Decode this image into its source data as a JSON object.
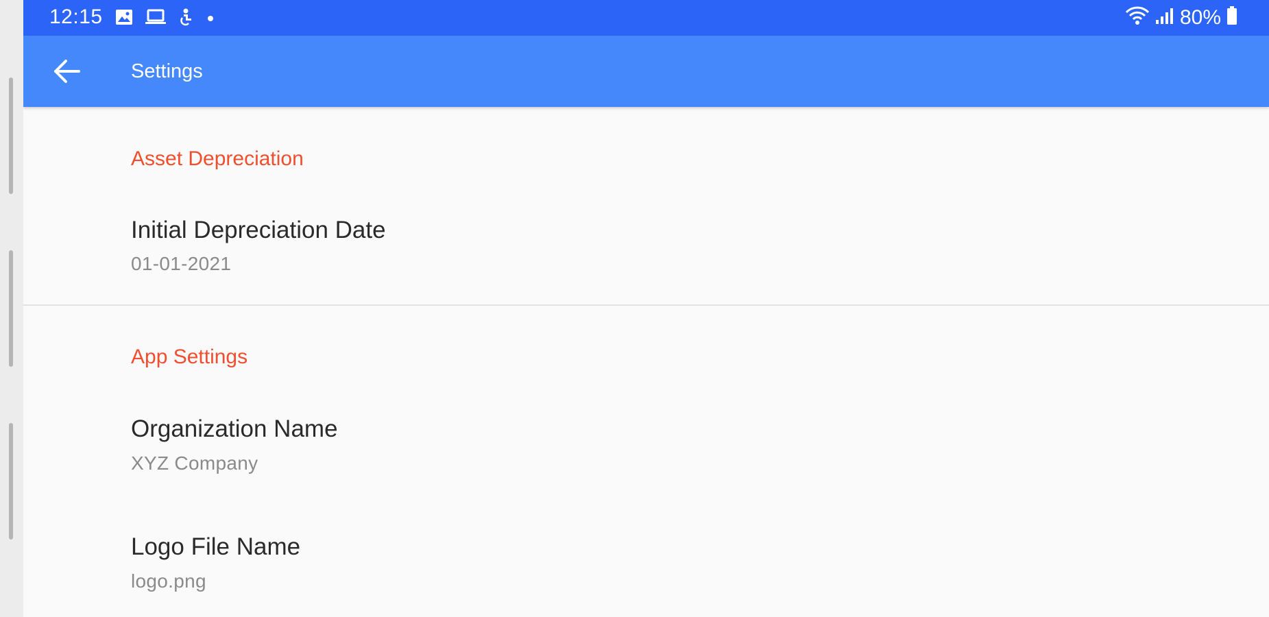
{
  "status_bar": {
    "time": "12:15",
    "battery": "80%",
    "left_icons": [
      "image-icon",
      "laptop-icon",
      "accessibility-icon",
      "dot-icon"
    ],
    "right_icons": [
      "wifi-icon",
      "signal-icon",
      "battery-icon"
    ]
  },
  "app_bar": {
    "title": "Settings",
    "back_icon": "arrow-back-icon"
  },
  "sections": [
    {
      "header": "Asset Depreciation",
      "items": [
        {
          "title": "Initial Depreciation Date",
          "summary": "01-01-2021"
        }
      ]
    },
    {
      "header": "App Settings",
      "items": [
        {
          "title": "Organization Name",
          "summary": "XYZ Company"
        },
        {
          "title": "Logo File Name",
          "summary": "logo.png"
        }
      ]
    }
  ],
  "colors": {
    "status_bar": "#2c64f7",
    "app_bar": "#4588fb",
    "section_header": "#ef4f2f",
    "background": "#fafafa"
  }
}
